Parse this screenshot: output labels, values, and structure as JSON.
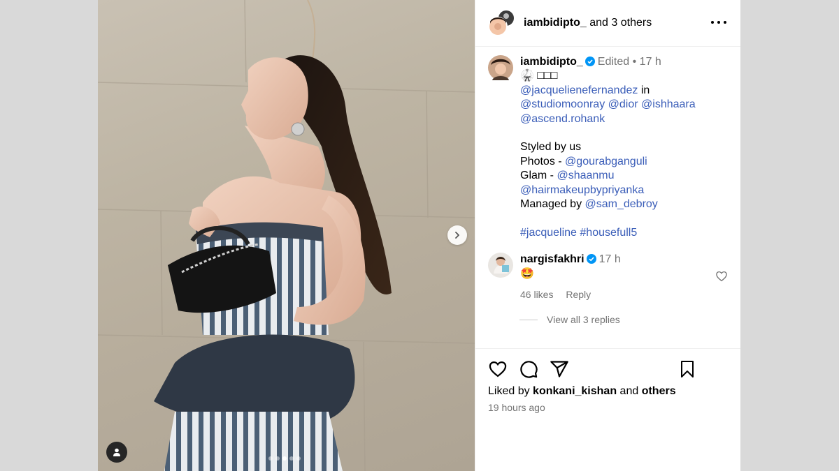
{
  "post": {
    "header": {
      "owner": "iambidipto_",
      "collab_suffix": "and 3 others"
    },
    "caption": {
      "username": "iambidipto_",
      "edited": "Edited",
      "separator": "•",
      "time": "17 h",
      "line1": "🥋 □□□",
      "mention_jacq": "@jacquelienefernandez",
      "word_in": "in",
      "mention_studio": "@studiomoonray",
      "mention_dior": "@dior",
      "mention_ishhaara": "@ishhaara",
      "mention_ascend": "@ascend.rohank",
      "styled": "Styled by us",
      "photos_label": "Photos -",
      "mention_gourab": "@gourabganguli",
      "glam_label": "Glam -",
      "mention_shaanmu": "@shaanmu",
      "mention_hair": "@hairmakeupbypriyanka",
      "managed_label": "Managed by",
      "mention_sam": "@sam_debroy",
      "hashtag1": "#jacqueline",
      "hashtag2": "#housefull5"
    },
    "comment": {
      "username": "nargisfakhri",
      "time": "17 h",
      "text": "🤩",
      "likes": "46 likes",
      "reply": "Reply",
      "view_replies": "View all 3 replies"
    },
    "likes_row": {
      "prefix": "Liked by",
      "user": "konkani_kishan",
      "and": "and",
      "others": "others"
    },
    "timestamp": "19 hours ago",
    "carousel": {
      "slides": 5,
      "active_index": 2
    },
    "colors": {
      "link": "#3a5db8",
      "verified": "#0095f6",
      "secondary": "#737373"
    },
    "icons": [
      "more-icon",
      "verified-icon",
      "chevron-right-icon",
      "user-tag-icon",
      "heart-icon",
      "comment-icon",
      "share-icon",
      "bookmark-icon"
    ]
  }
}
